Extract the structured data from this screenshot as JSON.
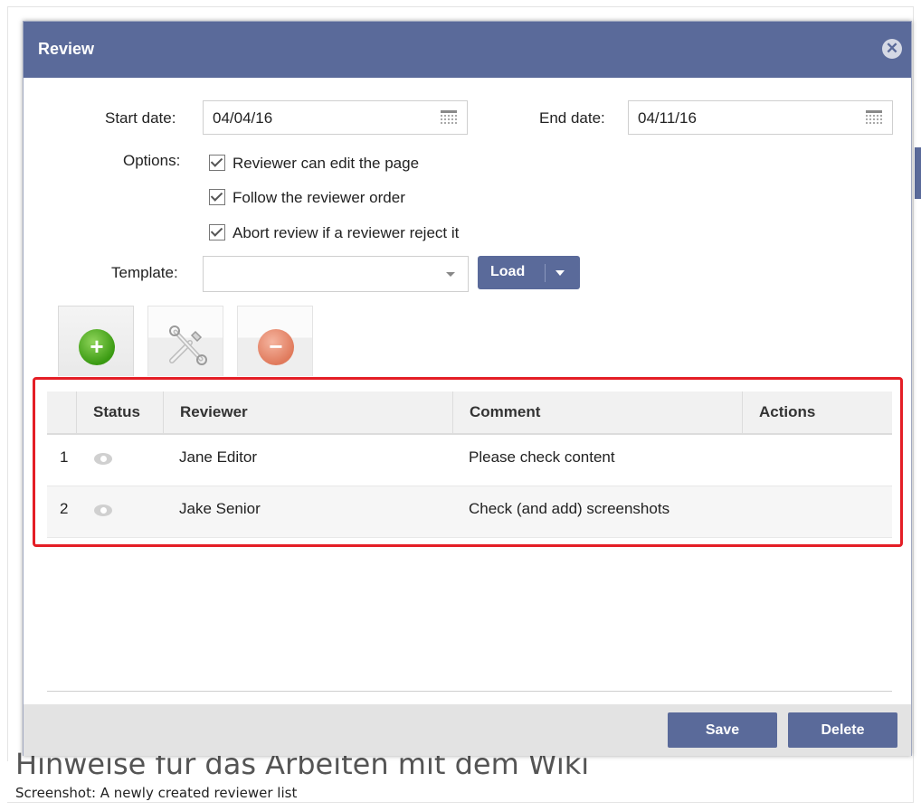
{
  "dialog": {
    "title": "Review",
    "close_icon": "close-circle-icon"
  },
  "form": {
    "start_date_label": "Start date:",
    "start_date_value": "04/04/16",
    "end_date_label": "End date:",
    "end_date_value": "04/11/16",
    "calendar_icon": "calendar-icon",
    "options_label": "Options:",
    "options": [
      {
        "label": "Reviewer can edit the page",
        "checked": true
      },
      {
        "label": "Follow the reviewer order",
        "checked": true
      },
      {
        "label": "Abort review if a reviewer reject it",
        "checked": true
      }
    ],
    "template_label": "Template:",
    "template_value": "",
    "load_label": "Load"
  },
  "toolbar": {
    "add_icon": "plus-circle-icon",
    "edit_icon": "wrench-screwdriver-icon",
    "remove_icon": "minus-circle-icon"
  },
  "grid": {
    "columns": [
      "",
      "Status",
      "Reviewer",
      "Comment",
      "Actions"
    ],
    "rows": [
      {
        "num": "1",
        "status_icon": "eye-icon",
        "reviewer": "Jane Editor",
        "comment": "Please check content",
        "actions": ""
      },
      {
        "num": "2",
        "status_icon": "eye-icon",
        "reviewer": "Jake Senior",
        "comment": "Check (and add) screenshots",
        "actions": ""
      }
    ]
  },
  "footer": {
    "save_label": "Save",
    "delete_label": "Delete"
  },
  "background": {
    "heading": "Hinweise für das Arbeiten mit dem Wiki",
    "caption": "Screenshot: A newly created reviewer list"
  },
  "colors": {
    "accent": "#5a6a9a",
    "highlight": "#e41e26",
    "add_green": "#3a9a12",
    "remove_salmon": "#e07a5c"
  }
}
